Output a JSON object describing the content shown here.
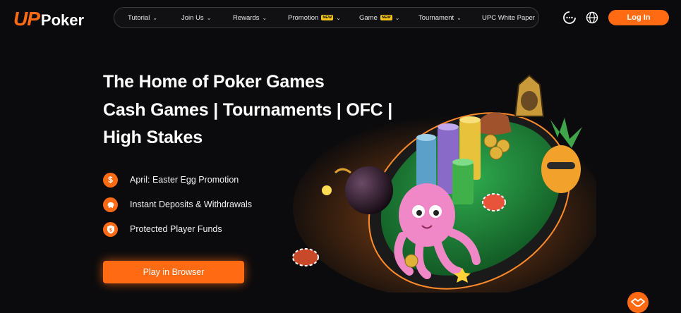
{
  "brand": {
    "up": "UP",
    "poker": "Poker"
  },
  "nav": {
    "items": [
      {
        "label": "Tutorial",
        "chevron": true
      },
      {
        "label": "Join Us",
        "chevron": true
      },
      {
        "label": "Rewards",
        "chevron": true
      },
      {
        "label": "Promotion",
        "badge": "NEW",
        "chevron": true
      },
      {
        "label": "Game",
        "badge": "NEW",
        "chevron": true
      },
      {
        "label": "Tournament",
        "chevron": true
      },
      {
        "label": "UPC White Paper",
        "chevron": false
      }
    ]
  },
  "header": {
    "login_label": "Log In"
  },
  "hero": {
    "line1": "The Home of Poker Games",
    "line2": "Cash Games | Tournaments | OFC |",
    "line3": "High Stakes"
  },
  "features": [
    {
      "label": "April: Easter Egg Promotion",
      "icon": "dollar-icon"
    },
    {
      "label": "Instant Deposits & Withdrawals",
      "icon": "piggy-bank-icon"
    },
    {
      "label": "Protected Player Funds",
      "icon": "shield-dollar-icon"
    }
  ],
  "cta": {
    "play_label": "Play in Browser"
  },
  "colors": {
    "accent": "#ff6a13",
    "background": "#0b0b0d",
    "table": "#1f8a3a",
    "badge": "#f5c518"
  }
}
